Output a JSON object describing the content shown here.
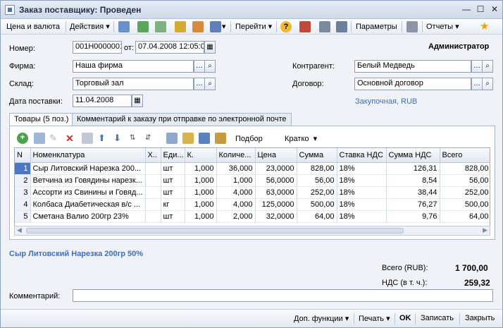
{
  "window": {
    "title": "Заказ поставщику: Проведен"
  },
  "toolbar": {
    "price_currency": "Цена и валюта",
    "actions": "Действия",
    "go": "Перейти",
    "params": "Параметры",
    "reports": "Отчеты"
  },
  "header": {
    "user": "Администратор",
    "number_label": "Номер:",
    "number": "001Н0000001",
    "from_label": "от:",
    "date": "07.04.2008 12:05:0",
    "firm_label": "Фирма:",
    "firm": "Наша фирма",
    "contractor_label": "Контрагент:",
    "contractor": "Белый Медведь",
    "warehouse_label": "Склад:",
    "warehouse": "Торговый зал",
    "contract_label": "Договор:",
    "contract": "Основной договор",
    "delivery_label": "Дата поставки:",
    "delivery_date": "11.04.2008",
    "price_type_link": "Закупочная, RUB"
  },
  "tabs": [
    {
      "label": "Товары (5 поз.)"
    },
    {
      "label": "Комментарий к заказу при отправке по электронной почте"
    }
  ],
  "grid_toolbar": {
    "selection": "Подбор",
    "mode": "Кратко"
  },
  "table": {
    "columns": [
      "N",
      "Номенклатура",
      "Х..",
      "Еди...",
      "К.",
      "Количе...",
      "Цена",
      "Сумма",
      "Ставка НДС",
      "Сумма НДС",
      "Всего"
    ],
    "rows": [
      [
        "1",
        "Сыр Литовский Нарезка 200...",
        "",
        "шт",
        "1,000",
        "36,000",
        "23,0000",
        "828,00",
        "18%",
        "126,31",
        "828,00"
      ],
      [
        "2",
        "Ветчина из Говядины нарезк...",
        "",
        "шт",
        "1,000",
        "1,000",
        "56,0000",
        "56,00",
        "18%",
        "8,54",
        "56,00"
      ],
      [
        "3",
        "Ассорти из Свинины и Говяд...",
        "",
        "шт",
        "1,000",
        "4,000",
        "63,0000",
        "252,00",
        "18%",
        "38,44",
        "252,00"
      ],
      [
        "4",
        "Колбаса Диабетическая в/с ...",
        "",
        "кг",
        "1,000",
        "4,000",
        "125,0000",
        "500,00",
        "18%",
        "76,27",
        "500,00"
      ],
      [
        "5",
        "Сметана Валио 200гр 23%",
        "",
        "шт",
        "1,000",
        "2,000",
        "32,0000",
        "64,00",
        "18%",
        "9,76",
        "64,00"
      ]
    ]
  },
  "selected_item": "Сыр Литовский Нарезка 200гр 50%",
  "totals": {
    "total_label": "Всего (RUB):",
    "total": "1 700,00",
    "vat_label": "НДС (в т. ч.):",
    "vat": "259,32"
  },
  "comment_label": "Комментарий:",
  "comment_value": "",
  "bottom": {
    "extra": "Доп. функции",
    "print": "Печать",
    "ok": "OK",
    "save": "Записать",
    "close": "Закрыть"
  }
}
